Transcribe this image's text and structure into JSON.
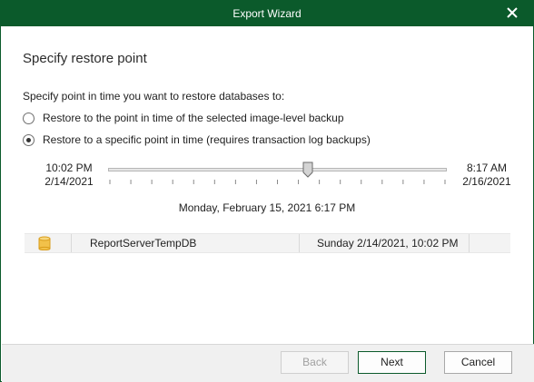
{
  "window": {
    "title": "Export Wizard",
    "title_bar_color": "#0b5a2b",
    "close_icon": "close-icon"
  },
  "step": {
    "heading": "Specify restore point",
    "prompt": "Specify point in time you want to restore databases to:"
  },
  "options": [
    {
      "label": "Restore to the point in time of the selected image-level backup",
      "selected": false
    },
    {
      "label": "Restore to a specific point in time (requires transaction log backups)",
      "selected": true
    }
  ],
  "slider": {
    "start_time": "10:02 PM",
    "start_date": "2/14/2021",
    "end_time": "8:17 AM",
    "end_date": "2/16/2021",
    "position_fraction": 0.59,
    "selected_label": "Monday, February 15, 2021 6:17 PM",
    "tick_count": 17
  },
  "database_rows": [
    {
      "icon": "database-icon",
      "name": "ReportServerTempDB",
      "restore_point": "Sunday 2/14/2021, 10:02 PM"
    }
  ],
  "buttons": {
    "back": "Back",
    "next": "Next",
    "cancel": "Cancel"
  }
}
